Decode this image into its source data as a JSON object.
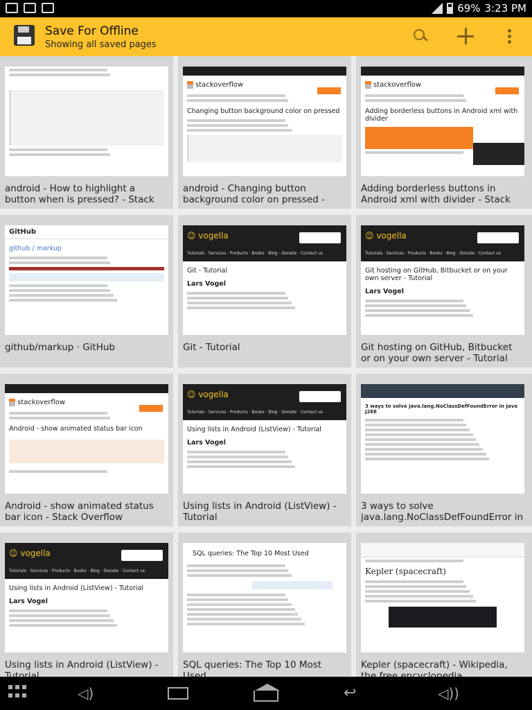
{
  "status_bar": {
    "battery": "69%",
    "time": "3:23 PM",
    "left_icons": [
      "image-icon",
      "mail-icon",
      "download-icon"
    ]
  },
  "app_bar": {
    "title": "Save For Offline",
    "subtitle": "Showing all saved pages",
    "actions": [
      "search-icon",
      "add-icon",
      "overflow-menu-icon"
    ]
  },
  "cards": [
    {
      "caption": "android - How to highlight a button when is pressed? - Stack Overflow",
      "kind": "so-answers"
    },
    {
      "caption": "android - Changing button background color on pressed - Stack",
      "kind": "so",
      "thumb_title": "Changing button background color on pressed"
    },
    {
      "caption": "Adding borderless buttons in Android xml with divider - Stack Overflow",
      "kind": "so-banner",
      "thumb_title": "Adding borderless buttons in Android xml with divider"
    },
    {
      "caption": "github/markup · GitHub",
      "kind": "github",
      "thumb_title": "github / markup"
    },
    {
      "caption": "Git - Tutorial",
      "kind": "vogella",
      "thumb_title": "Git - Tutorial",
      "thumb_author": "Lars Vogel"
    },
    {
      "caption": "Git hosting on GitHub, Bitbucket or on your own server - Tutorial",
      "kind": "vogella",
      "thumb_title": "Git hosting on GitHub, Bitbucket or on your own server - Tutorial",
      "thumb_author": "Lars Vogel"
    },
    {
      "caption": "Android - show animated status bar icon - Stack Overflow",
      "kind": "so-peach",
      "thumb_title": "Android - show animated status bar icon"
    },
    {
      "caption": "Using lists in Android (ListView) - Tutorial",
      "kind": "vogella",
      "thumb_title": "Using lists in Android (ListView) - Tutorial",
      "thumb_author": "Lars Vogel"
    },
    {
      "caption": "3 ways to solve java.lang.NoClassDefFoundError in",
      "kind": "java",
      "thumb_title": "3 ways to solve java.lang.NoClassDefFoundError in Java J2EE"
    },
    {
      "caption": "Using lists in Android (ListView) - Tutorial",
      "kind": "vogella",
      "thumb_title": "Using lists in Android (ListView) - Tutorial",
      "thumb_author": "Lars Vogel"
    },
    {
      "caption": "SQL queries: The Top 10 Most Used",
      "kind": "blog",
      "thumb_title": "SQL queries: The Top 10 Most Used"
    },
    {
      "caption": "Kepler (spacecraft) - Wikipedia, the free encyclopedia",
      "kind": "wiki",
      "thumb_title": "Kepler (spacecraft)"
    }
  ],
  "nav_bar": [
    "apps-grid-icon",
    "volume-down-icon",
    "recent-apps-icon",
    "home-icon",
    "back-icon",
    "volume-up-icon"
  ]
}
